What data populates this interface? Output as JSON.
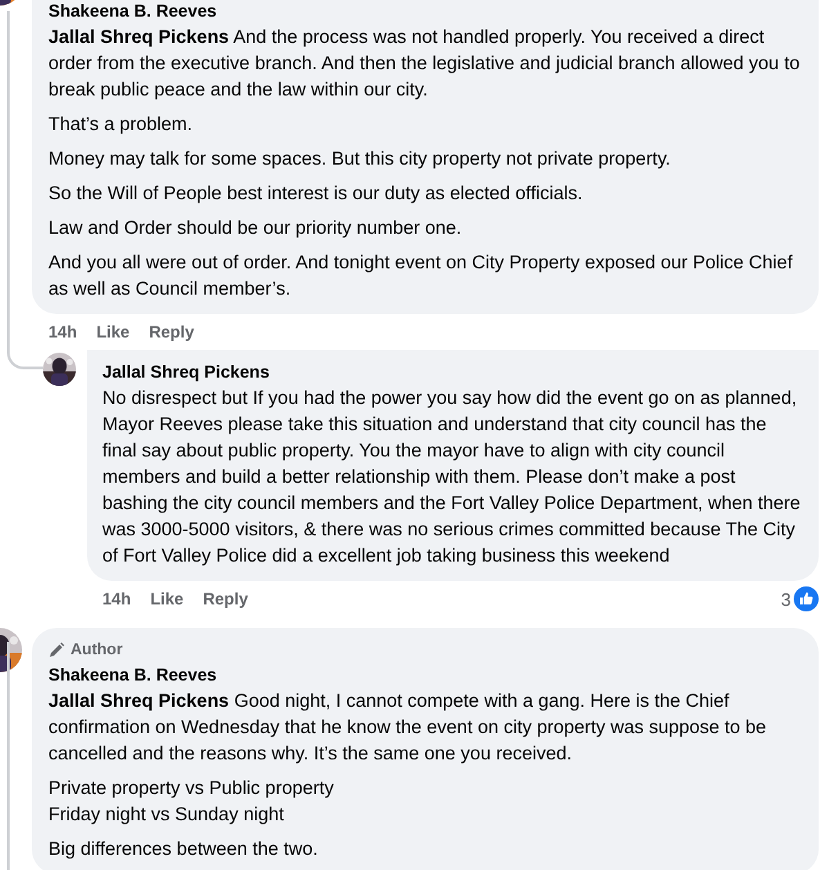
{
  "comments": [
    {
      "author": "Shakeena B. Reeves",
      "paragraphs": [
        "**Jallal Shreq Pickens** And the process was not handled properly. You received a direct order from the executive branch. And then the legislative and judicial branch allowed you to break public peace and the law within our city.",
        "That’s a problem.",
        "Money may talk for some spaces. But this city property not private property.",
        "So the Will of People best interest is our duty as elected officials.",
        "Law and Order should be our priority number one.",
        "And you all were out of order. And tonight event on City Property exposed our Police Chief as well as Council member’s."
      ],
      "time": "14h",
      "like": "Like",
      "reply": "Reply",
      "replies": [
        {
          "author": "Jallal Shreq Pickens",
          "paragraphs": [
            "No disrespect but If you had the power you say how did the event go on as planned, Mayor Reeves please take this situation and understand that city council has the final say about public property. You the mayor have to align with city council members and build a better relationship with them. Please don’t make a post bashing the city council members and the Fort Valley Police Department, when there was 3000-5000 visitors, & there was no serious crimes committed because The City of Fort Valley Police did a excellent job taking business this weekend"
          ],
          "time": "14h",
          "like": "Like",
          "reply": "Reply",
          "reaction_count": "3"
        }
      ]
    },
    {
      "badge": "Author",
      "author": "Shakeena B. Reeves",
      "paragraphs": [
        "**Jallal Shreq Pickens** Good night, I cannot compete with a gang. Here is the Chief confirmation on Wednesday that he know the event on city property was suppose to be cancelled and the reasons why. It’s the same one you received.",
        "Private property vs Public property\nFriday night vs Sunday night",
        "Big differences between the two."
      ]
    }
  ]
}
